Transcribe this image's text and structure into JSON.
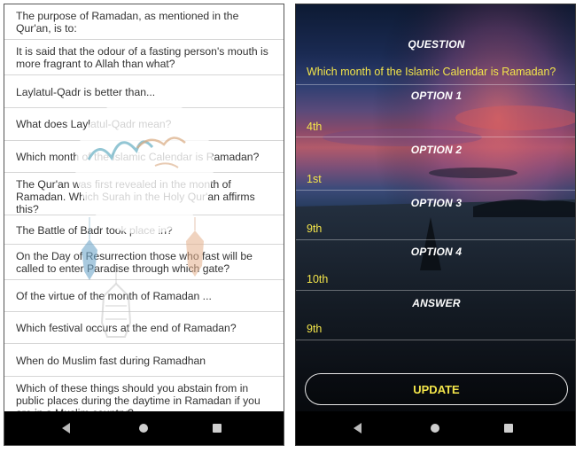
{
  "left_screen": {
    "questions": [
      "The purpose of Ramadan, as mentioned in the Qur'an, is to:",
      "It is said that the odour of a fasting person's mouth is more fragrant to Allah than what?",
      "Laylatul-Qadr is better than...",
      "What does Laylatul-Qadr mean?",
      "Which month of the Islamic Calendar is Ramadan?",
      "The Qur'an was first revealed in the month of Ramadan. Which Surah in the Holy Qur'an affirms this?",
      "The Battle of Badr took place in?",
      "On the Day of Resurrection those who fast will be called to enter Paradise through which gate?",
      "Of the virtue of the month of Ramadan ...",
      "Which festival occurs at the end of Ramadan?",
      "When do Muslim fast during Ramadhan",
      "Which of these things should you abstain from in public places during the daytime in Ramadan if you are in a Muslim country?"
    ],
    "nav": {
      "back": "back-icon",
      "home": "home-icon",
      "recents": "recents-icon"
    }
  },
  "right_screen": {
    "question_label": "QUESTION",
    "question_text": "Which month of the Islamic Calendar is Ramadan?",
    "option1_label": "OPTION 1",
    "option1_value": "4th",
    "option2_label": "OPTION 2",
    "option2_value": "1st",
    "option3_label": "OPTION 3",
    "option3_value": "9th",
    "option4_label": "OPTION 4",
    "option4_value": "10th",
    "answer_label": "ANSWER",
    "answer_value": "9th",
    "update_label": "UPDATE",
    "nav": {
      "back": "back-icon",
      "home": "home-icon",
      "recents": "recents-icon"
    }
  },
  "colors": {
    "accent_yellow": "#f3e54a",
    "label_white": "#ffffff",
    "list_text": "#333333"
  }
}
